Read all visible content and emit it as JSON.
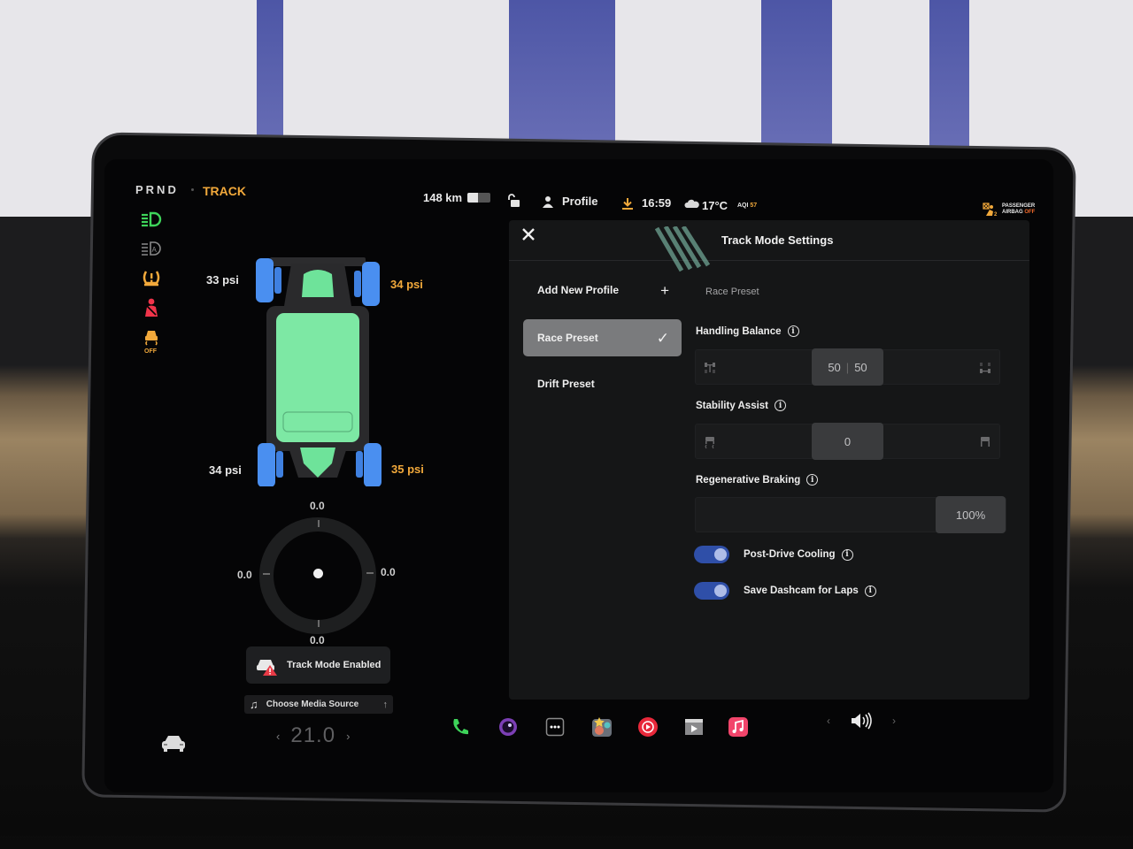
{
  "drive": {
    "gears": "PRND",
    "mode": "TRACK",
    "telltales": [
      "headlight-on-icon",
      "auto-headlight-icon",
      "tire-pressure-warning-icon",
      "seatbelt-warning-icon",
      "traction-control-off-icon"
    ],
    "traction_off_label": "OFF"
  },
  "tires": {
    "front_left": "33 psi",
    "front_right": "34 psi",
    "rear_left": "34 psi",
    "rear_right": "35 psi"
  },
  "g_meter": {
    "top": "0.0",
    "bottom": "0.0",
    "left": "0.0",
    "right": "0.0"
  },
  "notification": {
    "text": "Track Mode Enabled"
  },
  "media": {
    "label": "Choose Media Source"
  },
  "climate": {
    "temperature": "21.0"
  },
  "status_bar": {
    "range": "148 km",
    "battery_level": 0.45,
    "profile_label": "Profile",
    "time": "16:59",
    "weather_temp": "17°C",
    "aqi_label": "AQI",
    "aqi_value": "57",
    "airbag_line1": "PASSENGER",
    "airbag_line2": "AIRBAG",
    "airbag_state": "OFF"
  },
  "track_settings": {
    "title": "Track Mode Settings",
    "profiles": [
      {
        "label": "Add New Profile",
        "trail": "+"
      },
      {
        "label": "Race Preset",
        "trail": "✓",
        "selected": true
      },
      {
        "label": "Drift Preset"
      }
    ],
    "active_profile": "Race Preset",
    "handling_balance": {
      "label": "Handling Balance",
      "front": "50",
      "rear": "50",
      "position_fraction": 0.5
    },
    "stability_assist": {
      "label": "Stability Assist",
      "value": "0",
      "position_fraction": 0.5
    },
    "regenerative_braking": {
      "label": "Regenerative Braking",
      "value": "100%",
      "position_fraction": 1.0
    },
    "toggles": [
      {
        "label": "Post-Drive Cooling",
        "on": true
      },
      {
        "label": "Save Dashcam for Laps",
        "on": true
      }
    ]
  },
  "dock": [
    "phone-icon",
    "camera-icon",
    "more-apps-icon",
    "toybox-icon",
    "youtube-music-icon",
    "theater-icon",
    "apple-music-icon"
  ],
  "colors": {
    "accent_orange": "#f2a93b",
    "toggle_blue": "#2f4fa8",
    "selected_profile": "#7a7b7d",
    "chassis_green": "#6ee39a",
    "tire_blue": "#4a8ff0"
  }
}
